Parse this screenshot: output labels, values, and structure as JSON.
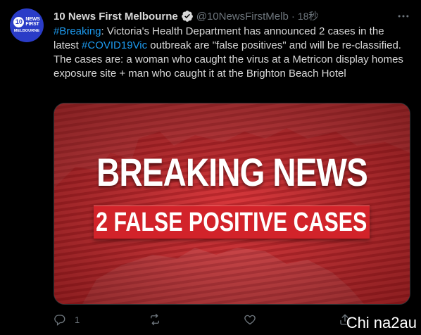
{
  "author": {
    "display_name": "10 News First Melbourne",
    "handle": "@10NewsFirstMelb",
    "time": "18秒",
    "avatar": {
      "logo_number": "10",
      "logo_text_1": "NEWS",
      "logo_text_2": "FIRST",
      "city": "MELBOURNE"
    },
    "verified_icon": "verified-badge-icon"
  },
  "tweet": {
    "hashtag_1": "#Breaking",
    "text_1": ": Victoria's Health Department has announced 2 cases in the latest ",
    "hashtag_2": "#COVID19Vic",
    "text_2": " outbreak are \"false positives\" and will be re-classified.",
    "text_3": "The cases are: a woman who caught the virus at a Metricon display homes exposure site + man who caught it at the Brighton Beach Hotel"
  },
  "media": {
    "headline": "BREAKING NEWS",
    "subheadline": "2 FALSE POSITIVE CASES"
  },
  "actions": {
    "reply_count": "1",
    "reply_icon": "reply-icon",
    "retweet_icon": "retweet-icon",
    "like_icon": "heart-icon",
    "share_icon": "share-icon"
  },
  "watermark": "Chi na2au",
  "colors": {
    "background": "#000000",
    "link": "#1d9bf0",
    "muted": "#6e767d",
    "banner_red": "#d2232a"
  }
}
